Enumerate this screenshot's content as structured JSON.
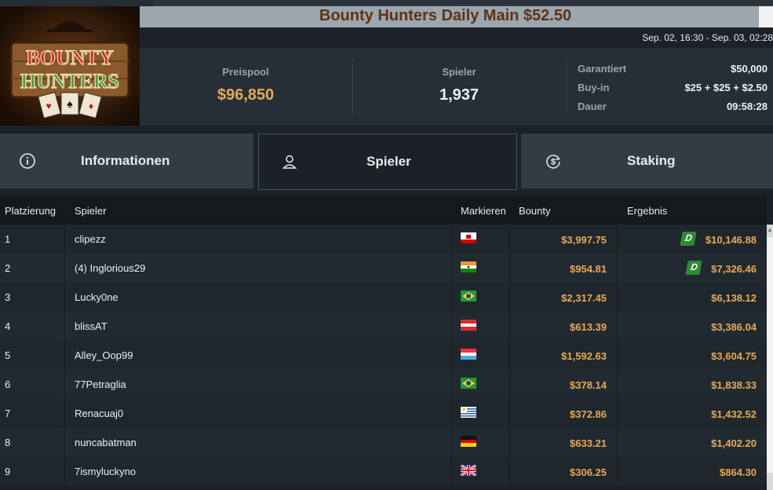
{
  "tournament": {
    "title": "Bounty Hunters Daily Main $52.50",
    "dates": "Sep. 02, 16:30 - Sep. 03, 02:28",
    "logo_text": [
      "BOUNTY",
      "HUNTERS"
    ]
  },
  "stats": {
    "prizepool_label": "Preispool",
    "prizepool_value": "$96,850",
    "players_label": "Spieler",
    "players_value": "1,937",
    "details": [
      {
        "key": "Garantiert",
        "value": "$50,000"
      },
      {
        "key": "Buy-in",
        "value": "$25 + $25 + $2.50"
      },
      {
        "key": "Dauer",
        "value": "09:58:28"
      }
    ]
  },
  "tabs": [
    {
      "label": "Informationen",
      "icon": "info-icon",
      "active": false
    },
    {
      "label": "Spieler",
      "icon": "user-icon",
      "active": true
    },
    {
      "label": "Staking",
      "icon": "staking-icon",
      "active": false
    }
  ],
  "table": {
    "headers": [
      "Platzierung",
      "Spieler",
      "Markieren",
      "Bounty",
      "Ergebnis"
    ],
    "rows": [
      {
        "place": "1",
        "player": "clipezz",
        "flag": "gibraltar-flag",
        "bounty": "$3,997.75",
        "result": "$10,146.88",
        "deal": true
      },
      {
        "place": "2",
        "player": "(4) Inglorious29",
        "flag": "india-flag",
        "bounty": "$954.81",
        "result": "$7,326.46",
        "deal": true
      },
      {
        "place": "3",
        "player": "Lucky0ne",
        "flag": "brazil-flag",
        "bounty": "$2,317.45",
        "result": "$6,138.12",
        "deal": false
      },
      {
        "place": "4",
        "player": "blissAT",
        "flag": "austria-flag",
        "bounty": "$613.39",
        "result": "$3,386.04",
        "deal": false
      },
      {
        "place": "5",
        "player": "Alley_Oop99",
        "flag": "luxembourg-flag",
        "bounty": "$1,592.63",
        "result": "$3,604.75",
        "deal": false
      },
      {
        "place": "6",
        "player": "77Petraglia",
        "flag": "brazil-flag",
        "bounty": "$378.14",
        "result": "$1,838.33",
        "deal": false
      },
      {
        "place": "7",
        "player": "Renacuaj0",
        "flag": "uruguay-flag",
        "bounty": "$372.86",
        "result": "$1,432.52",
        "deal": false
      },
      {
        "place": "8",
        "player": "nuncabatman",
        "flag": "germany-flag",
        "bounty": "$633.21",
        "result": "$1,402.20",
        "deal": false
      },
      {
        "place": "9",
        "player": "7ismyluckyno",
        "flag": "uk-flag",
        "bounty": "$306.25",
        "result": "$864.30",
        "deal": false
      }
    ],
    "deal_badge": "D"
  },
  "colors": {
    "accent_gold": "#e8a955",
    "title_brown": "#5e3315",
    "deal_green": "#2f8a34"
  }
}
